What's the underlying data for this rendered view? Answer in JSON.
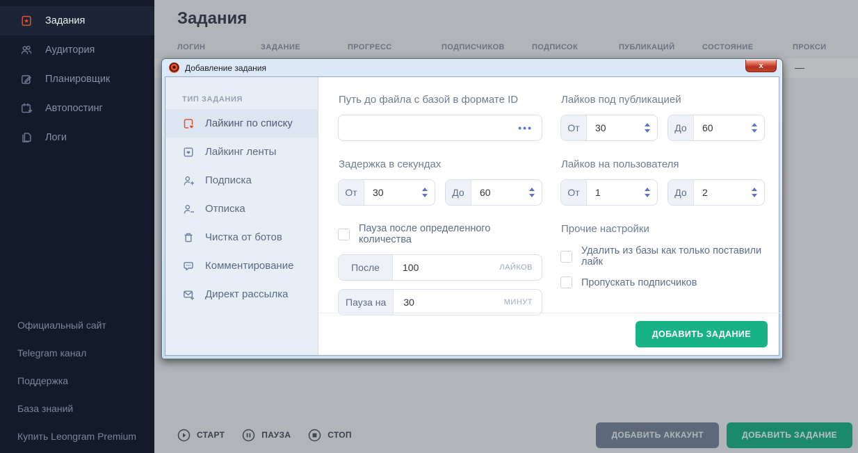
{
  "sidebar": {
    "items": [
      {
        "label": "Задания",
        "icon": "tasks-icon",
        "active": true
      },
      {
        "label": "Аудитория",
        "icon": "audience-icon",
        "active": false
      },
      {
        "label": "Планировщик",
        "icon": "planner-icon",
        "active": false
      },
      {
        "label": "Автопостинг",
        "icon": "autoposting-icon",
        "active": false
      },
      {
        "label": "Логи",
        "icon": "logs-icon",
        "active": false
      }
    ],
    "links": [
      {
        "label": "Официальный сайт"
      },
      {
        "label": "Telegram канал"
      },
      {
        "label": "Поддержка"
      },
      {
        "label": "База знаний"
      },
      {
        "label": "Купить Leongram Premium"
      }
    ]
  },
  "main": {
    "title": "Задания",
    "table": {
      "columns": [
        {
          "label": "ЛОГИН"
        },
        {
          "label": "ЗАДАНИЕ"
        },
        {
          "label": "ПРОГРЕСС"
        },
        {
          "label": "ПОДПИСЧИКОВ"
        },
        {
          "label": "ПОДПИСОК"
        },
        {
          "label": "ПУБЛИКАЦИЙ"
        },
        {
          "label": "СОСТОЯНИЕ"
        },
        {
          "label": "ПРОКСИ"
        }
      ],
      "row": {
        "proxy": "—"
      }
    },
    "controls": [
      {
        "label": "СТАРТ",
        "icon": "play-icon"
      },
      {
        "label": "ПАУЗА",
        "icon": "pause-icon"
      },
      {
        "label": "СТОП",
        "icon": "stop-icon"
      }
    ],
    "buttons": [
      {
        "label": "ДОБАВИТЬ АККАУНТ"
      },
      {
        "label": "ДОБАВИТЬ ЗАДАНИЕ"
      }
    ]
  },
  "modal": {
    "title": "Добавление задания",
    "close_label": "x",
    "task_types": {
      "header": "ТИП ЗАДАНИЯ",
      "items": [
        {
          "label": "Лайкинг по списку",
          "icon": "bookmark-heart-icon",
          "active": true
        },
        {
          "label": "Лайкинг ленты",
          "icon": "image-heart-icon",
          "active": false
        },
        {
          "label": "Подписка",
          "icon": "user-plus-icon",
          "active": false
        },
        {
          "label": "Отписка",
          "icon": "user-minus-icon",
          "active": false
        },
        {
          "label": "Чистка от ботов",
          "icon": "trash-icon",
          "active": false
        },
        {
          "label": "Комментирование",
          "icon": "comment-icon",
          "active": false
        },
        {
          "label": "Директ рассылка",
          "icon": "mail-plus-icon",
          "active": false
        }
      ]
    },
    "form": {
      "file": {
        "label": "Путь до файла с базой в формате ID",
        "value": "",
        "browse": "•••"
      },
      "delay": {
        "label": "Задержка в секундах",
        "from_prefix": "От",
        "from_value": "30",
        "to_prefix": "До",
        "to_value": "60"
      },
      "pause_checkbox": {
        "label": "Пауза после определенного количества",
        "checked": false
      },
      "after": {
        "prefix": "После",
        "value": "100",
        "suffix": "ЛАЙКОВ"
      },
      "pause_for": {
        "prefix": "Пауза на",
        "value": "30",
        "suffix": "МИНУТ"
      },
      "likes_post": {
        "label": "Лайков под публикацией",
        "from_prefix": "От",
        "from_value": "30",
        "to_prefix": "До",
        "to_value": "60"
      },
      "likes_user": {
        "label": "Лайков на пользователя",
        "from_prefix": "От",
        "from_value": "1",
        "to_prefix": "До",
        "to_value": "2"
      },
      "other": {
        "label": "Прочие настройки",
        "options": [
          {
            "label": "Удалить из базы как только поставили лайк",
            "checked": false
          },
          {
            "label": "Пропускать подписчиков",
            "checked": false
          }
        ]
      },
      "submit_label": "ДОБАВИТЬ ЗАДАНИЕ"
    }
  },
  "colors": {
    "accent_green": "#17b286",
    "accent_orange": "#e2542c",
    "sidebar_bg": "#121a2b",
    "modal_panel_bg": "#e8eef5"
  }
}
